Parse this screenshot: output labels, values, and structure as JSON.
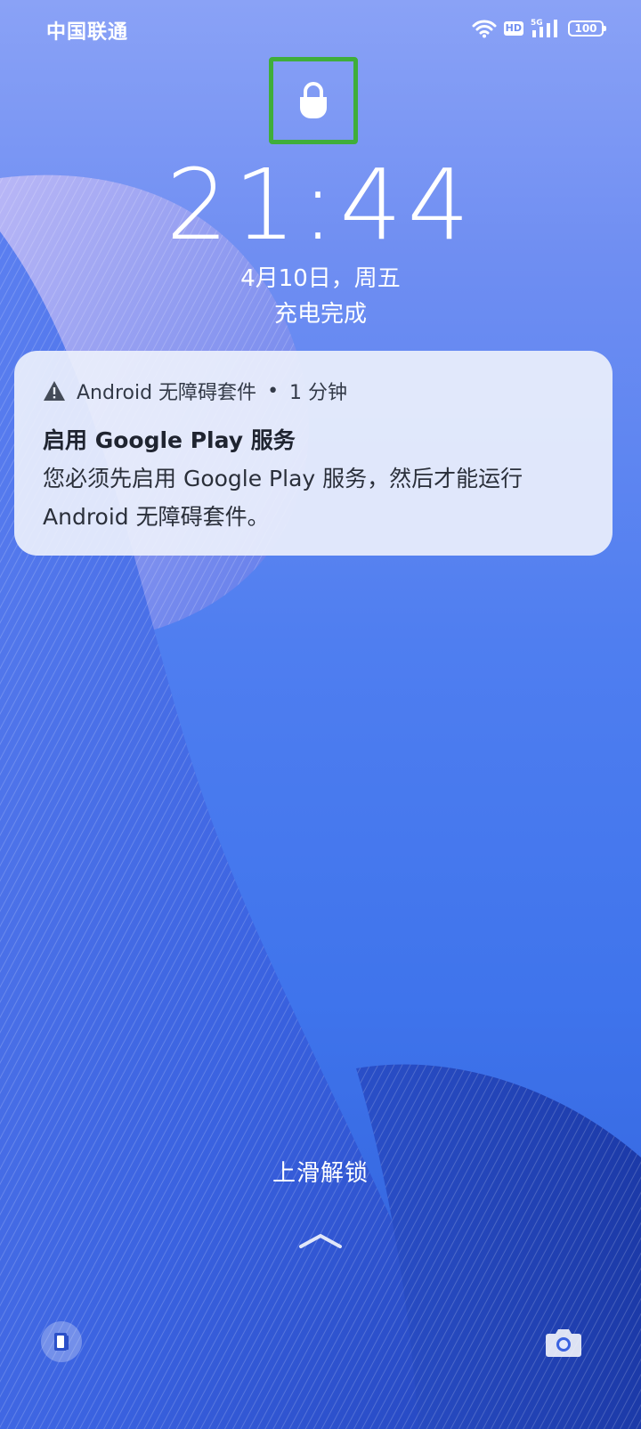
{
  "status_bar": {
    "carrier": "中国联通",
    "hd_label": "HD",
    "network_label": "5G",
    "battery_level": "100"
  },
  "lock_screen": {
    "time": "21:44",
    "date": "4月10日，周五",
    "charge_status": "充电完成",
    "unlock_hint": "上滑解锁"
  },
  "notification": {
    "app_name": "Android 无障碍套件",
    "separator": "•",
    "time_ago": "1 分钟",
    "title": "启用 Google Play 服务",
    "body": "您必须先启用 Google Play 服务，然后才能运行 Android 无障碍套件。"
  },
  "colors": {
    "lock_highlight": "#3fae3a",
    "wallpaper_top": "#8aa2f6",
    "wallpaper_bottom": "#2f5fd8"
  },
  "icons": {
    "lock": "lock-icon",
    "warning": "warning-icon",
    "wifi": "wifi-icon",
    "signal": "signal-icon",
    "battery": "battery-icon",
    "chevron": "chevron-up-icon",
    "wallet": "wallet-icon",
    "camera": "camera-icon"
  }
}
